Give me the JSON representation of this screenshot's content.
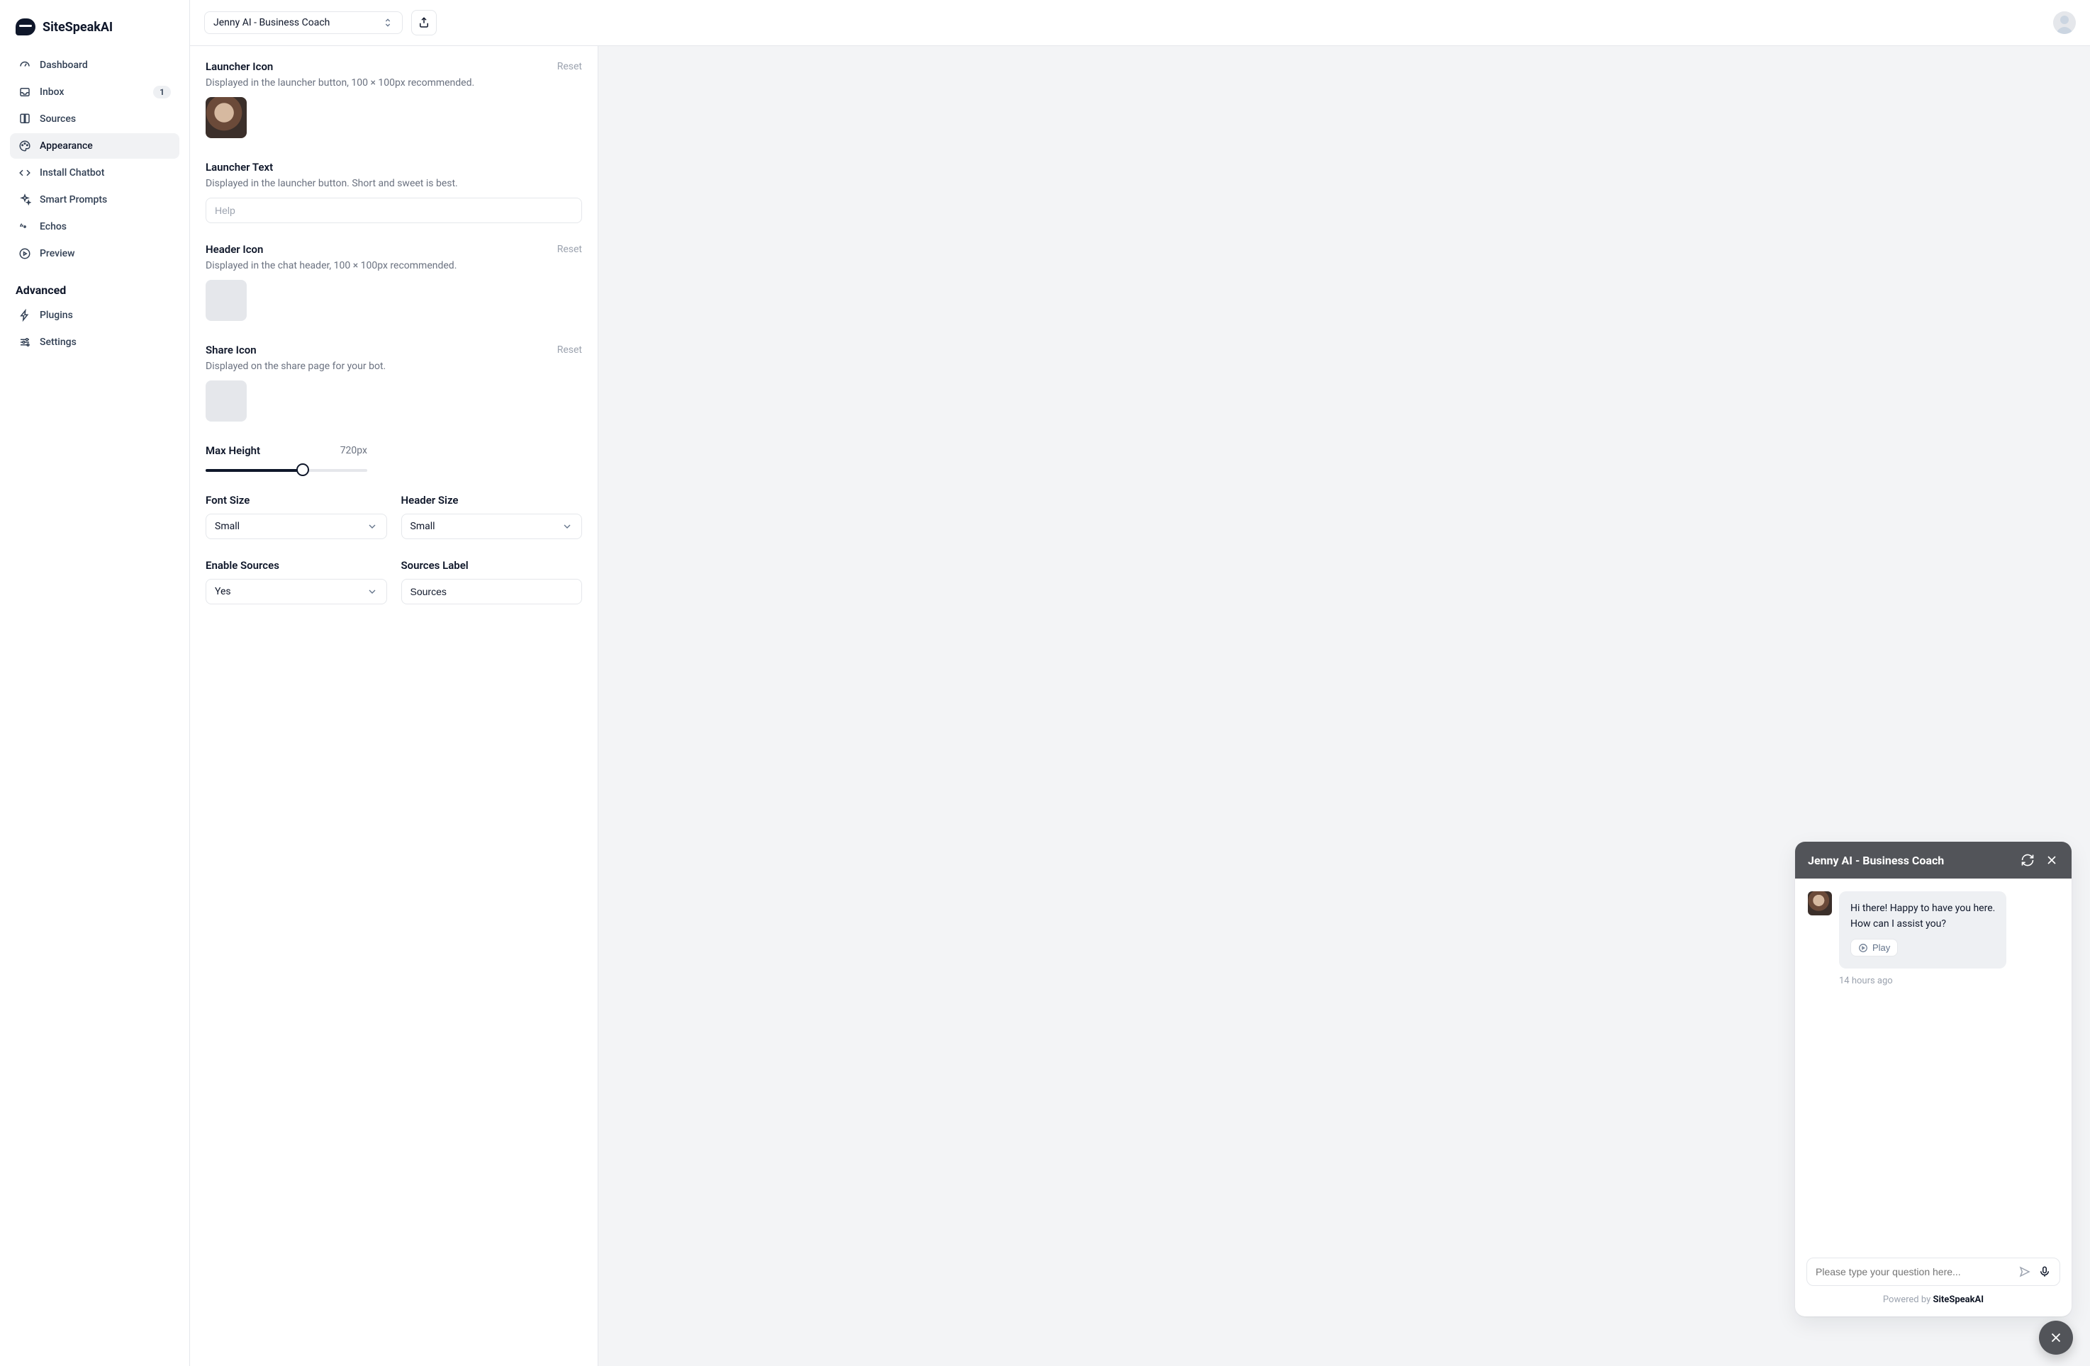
{
  "brand": {
    "name": "SiteSpeakAI"
  },
  "topbar": {
    "project_name": "Jenny AI - Business Coach"
  },
  "sidebar": {
    "items": [
      {
        "label": "Dashboard"
      },
      {
        "label": "Inbox",
        "badge": "1"
      },
      {
        "label": "Sources"
      },
      {
        "label": "Appearance"
      },
      {
        "label": "Install Chatbot"
      },
      {
        "label": "Smart Prompts"
      },
      {
        "label": "Echos"
      },
      {
        "label": "Preview"
      }
    ],
    "advanced_title": "Advanced",
    "advanced_items": [
      {
        "label": "Plugins"
      },
      {
        "label": "Settings"
      }
    ]
  },
  "settings": {
    "reset_label": "Reset",
    "launcher_icon": {
      "title": "Launcher Icon",
      "desc": "Displayed in the launcher button, 100 × 100px recommended."
    },
    "launcher_text": {
      "title": "Launcher Text",
      "desc": "Displayed in the launcher button. Short and sweet is best.",
      "placeholder": "Help"
    },
    "header_icon": {
      "title": "Header Icon",
      "desc": "Displayed in the chat header, 100 × 100px recommended."
    },
    "share_icon": {
      "title": "Share Icon",
      "desc": "Displayed on the share page for your bot."
    },
    "max_height": {
      "title": "Max Height",
      "value_label": "720px",
      "percent": 60
    },
    "font_size": {
      "title": "Font Size",
      "value": "Small"
    },
    "header_size": {
      "title": "Header Size",
      "value": "Small"
    },
    "enable_sources": {
      "title": "Enable Sources",
      "value": "Yes"
    },
    "sources_label": {
      "title": "Sources Label",
      "value": "Sources"
    }
  },
  "chat": {
    "header_title": "Jenny AI - Business Coach",
    "message_lines": [
      "Hi there! Happy to have you here.",
      "How can I assist you?"
    ],
    "play_label": "Play",
    "time_label": "14 hours ago",
    "input_placeholder": "Please type your question here...",
    "powered_prefix": "Powered by ",
    "powered_name": "SiteSpeakAI"
  }
}
